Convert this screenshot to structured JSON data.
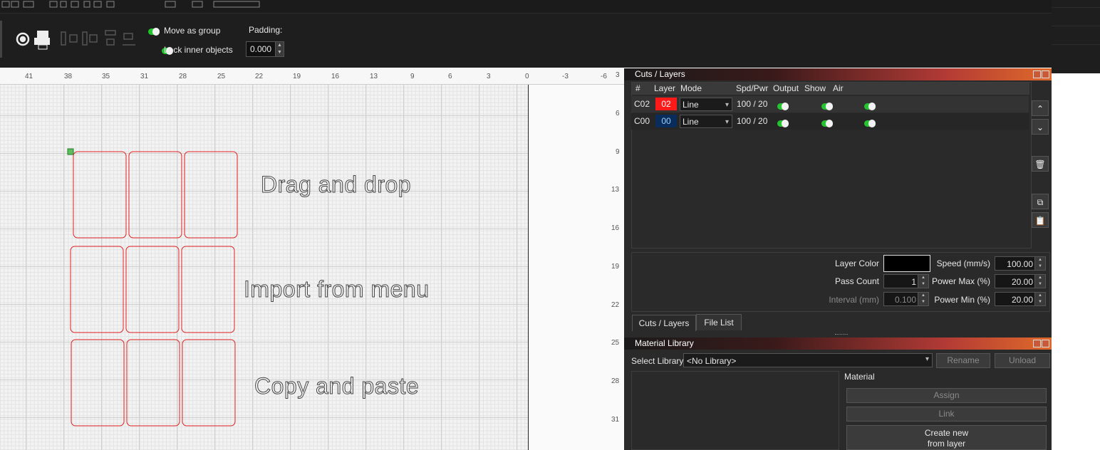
{
  "toolbar": {
    "move_as_group": "Move as group",
    "lock_inner_objects": "Lock inner objects",
    "padding_label": "Padding:",
    "padding_value": "0.000"
  },
  "ruler": {
    "x_ticks": [
      "41",
      "38",
      "35",
      "31",
      "28",
      "25",
      "22",
      "19",
      "16",
      "13",
      "9",
      "6",
      "3",
      "0",
      "-3",
      "-6"
    ],
    "y_ticks": [
      "3",
      "6",
      "9",
      "13",
      "16",
      "19",
      "22",
      "25",
      "28",
      "31"
    ]
  },
  "canvas": {
    "texts": [
      "Drag and drop",
      "Import from menu",
      "Copy and paste"
    ]
  },
  "cuts_layers": {
    "title": "Cuts / Layers",
    "headers": [
      "#",
      "Layer",
      "Mode",
      "Spd/Pwr",
      "Output",
      "Show",
      "Air"
    ],
    "rows": [
      {
        "id": "C02",
        "layer": "02",
        "mode": "Line",
        "spd_pwr": "100 / 20",
        "chip_color": "#ff1a1a"
      },
      {
        "id": "C00",
        "layer": "00",
        "mode": "Line",
        "spd_pwr": "100 / 20",
        "chip_color": "#0a2c5a"
      }
    ],
    "props": {
      "layer_color": "Layer Color",
      "pass_count": "Pass Count",
      "pass_count_value": "1",
      "interval": "Interval (mm)",
      "interval_value": "0.100",
      "speed": "Speed (mm/s)",
      "speed_value": "100.00",
      "power_max": "Power Max (%)",
      "power_max_value": "20.00",
      "power_min": "Power Min (%)",
      "power_min_value": "20.00"
    },
    "tabs": [
      "Cuts / Layers",
      "File List"
    ]
  },
  "material_library": {
    "title": "Material Library",
    "select_label": "Select Library",
    "select_value": "<No Library>",
    "rename": "Rename",
    "unload": "Unload",
    "material_label": "Material",
    "assign": "Assign",
    "link": "Link",
    "create_new_1": "Create new",
    "create_new_2": "from layer"
  }
}
